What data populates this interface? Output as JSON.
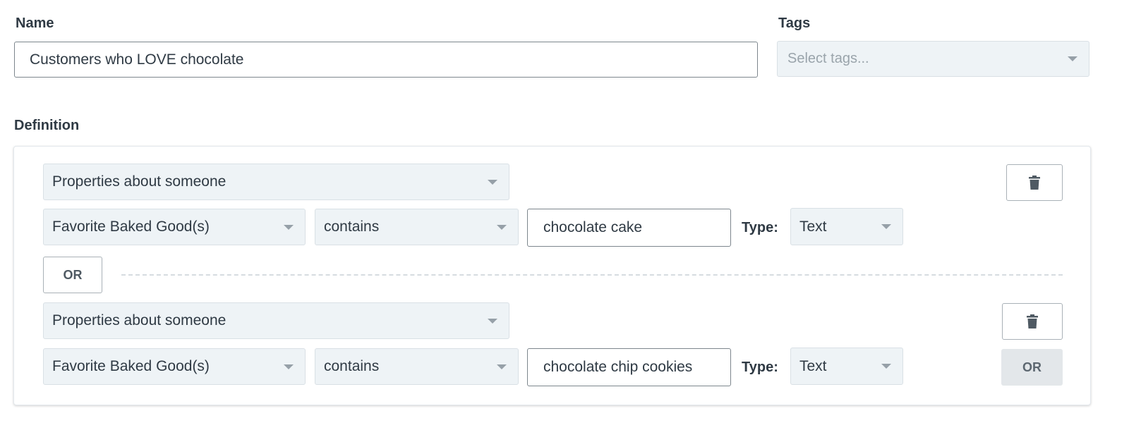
{
  "name_field": {
    "label": "Name",
    "value": "Customers who LOVE chocolate"
  },
  "tags_field": {
    "label": "Tags",
    "placeholder": "Select tags..."
  },
  "definition": {
    "label": "Definition",
    "conditions": [
      {
        "group_type": "Properties about someone",
        "property": "Favorite Baked Good(s)",
        "operator": "contains",
        "value": "chocolate cake",
        "type_label": "Type:",
        "type": "Text"
      },
      {
        "group_type": "Properties about someone",
        "property": "Favorite Baked Good(s)",
        "operator": "contains",
        "value": "chocolate chip cookies",
        "type_label": "Type:",
        "type": "Text"
      }
    ],
    "or_separator_label": "OR",
    "add_or_label": "OR"
  },
  "colors": {
    "select_bg": "#eef3f6",
    "text": "#2f3a44",
    "placeholder": "#9aa4ab",
    "button_gray": "#e3e7ea"
  },
  "icons": [
    "trash-icon",
    "caret-down-icon"
  ]
}
